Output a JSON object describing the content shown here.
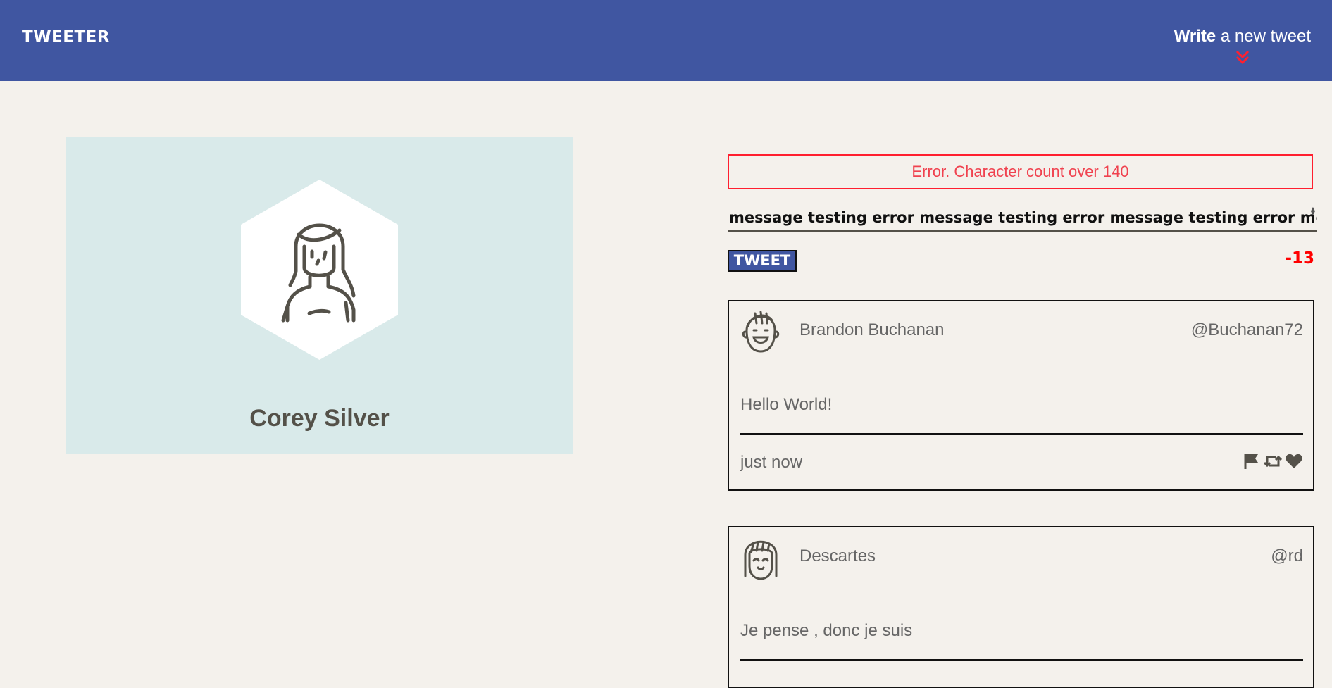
{
  "nav": {
    "brand": "TWEETER",
    "compose_bold": "Write",
    "compose_rest": " a new tweet"
  },
  "profile": {
    "name": "Corey Silver"
  },
  "compose": {
    "error": "Error. Character count over 140",
    "input_value": "message testing error message testing error message testing error message",
    "button_label": "TWEET",
    "counter": "-13"
  },
  "tweets": [
    {
      "name": "Brandon Buchanan",
      "handle": "@Buchanan72",
      "text": "Hello World!",
      "time": "just now",
      "avatar": "smiling-boy-avatar-icon"
    },
    {
      "name": "Descartes",
      "handle": "@rd",
      "text": "Je pense , donc je suis",
      "avatar": "smiling-girl-avatar-icon"
    }
  ],
  "icons": [
    "flag-icon",
    "retweet-icon",
    "heart-icon"
  ],
  "colors": {
    "nav": "#4056a1",
    "background": "#f4f1ec",
    "profile_panel": "#d9eaea",
    "error": "#ff1f2f",
    "counter": "#ff0000"
  }
}
